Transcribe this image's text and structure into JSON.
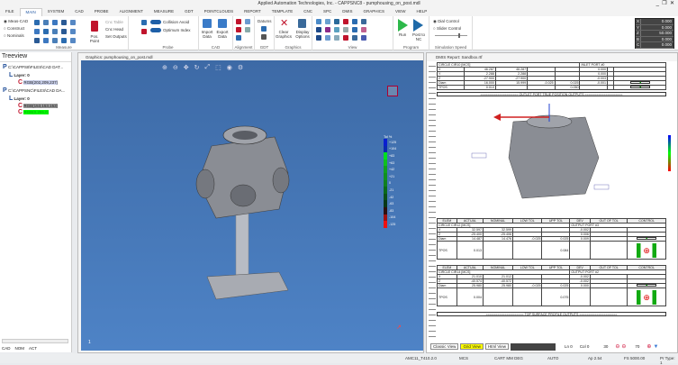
{
  "app": {
    "title": "Applied Automation Technologies, Inc. - CAPPSNC8 - pumphousing_on_post.mdl"
  },
  "tabs": [
    "FILE",
    "MAIN",
    "SYSTEM",
    "CAD",
    "PROBE",
    "ALIGNMENT",
    "MEASURE",
    "GDT",
    "POINTCLOUDS",
    "REPORT",
    "TEMPLATE",
    "CNC",
    "SPC",
    "DMIS",
    "GRAPHICS",
    "VIEW",
    "HELP"
  ],
  "ribbon": {
    "measure": {
      "radios": [
        "Meas-CAD",
        "Construct",
        "Nominals"
      ],
      "pos_point": "Pos. Point",
      "cnc_table": "Cnc Table",
      "cnc_head": "Cnc Head",
      "set_outputs": "Set Outputs",
      "label": "Measure"
    },
    "probe": {
      "collision": "Collision Avoid",
      "optimum": "Optimum Index",
      "label": "Probe"
    },
    "cad": {
      "import": "Import Data",
      "export": "Export Data",
      "label": "CAD"
    },
    "alignment": {
      "label": "Alignment"
    },
    "gdt": {
      "datums": "Datums",
      "label": "GDT"
    },
    "graphics": {
      "clear": "Clear Graphics",
      "display": "Display Options",
      "label": "Graphics"
    },
    "view": {
      "label": "View"
    },
    "program": {
      "run": "Run",
      "post": "Post to NC",
      "label": "Program"
    },
    "sim": {
      "dial": "Dial Control",
      "slider": "Slider Control",
      "label": "Simulation Speed"
    }
  },
  "dro": [
    {
      "axis": "X",
      "value": "0.000"
    },
    {
      "axis": "Y",
      "value": "0.000"
    },
    {
      "axis": "Z",
      "value": "50.000"
    },
    {
      "axis": "B",
      "value": "0.000"
    },
    {
      "axis": "C",
      "value": "0.000"
    }
  ],
  "tree": {
    "title": "Treeview",
    "p1": "C:\\CAPPS8\\FILES\\CAD DAT...",
    "layer1": "Layer: 0",
    "c1": "RGB(202,209,237)",
    "p2": "C:\\CAPPSNC\\FILES\\CAD DA...",
    "layer2": "Layer: 0",
    "c2": "RGB(153,153,153)",
    "c3": "RGB(0,255,0)",
    "tabs": [
      "CAD",
      "NOM",
      "ACT"
    ]
  },
  "graphics": {
    "title": "Graphics: pumphousing_on_post.mdl",
    "page": "1",
    "legend_title": "Tol %",
    "legend": [
      "+125",
      "+104",
      "+83",
      "+63",
      "+42",
      "+21",
      "0",
      "-21",
      "-42",
      "-63",
      "-83",
      "-104",
      "-125"
    ],
    "legend_colors": [
      "#0a1fd0",
      "#0a2ab0",
      "#00e020",
      "#10c020",
      "#10a020",
      "#109020",
      "#108020",
      "#0a6a1a",
      "#0a501a",
      "#083818",
      "#301010",
      "#a01010",
      "#f01010"
    ]
  },
  "report": {
    "title": "DMIS Report: Sandbox.rtf",
    "cols": [
      "ELEM",
      "ACTUAL",
      "NOMINAL",
      "LOW TOL",
      "UPP TOL",
      "DEV",
      "OUT OF TOL",
      "CONTROL"
    ],
    "t1": {
      "feature": "CIRCLE CIR10 [MCS]",
      "label": "INLET PORT #0",
      "rows": [
        [
          "X",
          "46.287",
          "46.287",
          "",
          "",
          "0.000"
        ],
        [
          "Y",
          "2.288",
          "2.288",
          "",
          "",
          "0.000"
        ],
        [
          "Z",
          "-27.900",
          "-27.900",
          "",
          "",
          "-0.003"
        ],
        [
          "Diam",
          "16.000",
          "15.999",
          "-0.025",
          "0.025",
          "-0.001"
        ],
        [
          "TPOS",
          "0.010",
          "",
          "",
          "0.050",
          ""
        ]
      ]
    },
    "banner1": "====================  OUTLET PORT TRUE POSITION OUTPUTS  ====================",
    "t2": {
      "num": "7",
      "feature": "CIRCLE CIR12 [MCS]",
      "label": "OUTPUT PORT #3",
      "rows": [
        [
          "X",
          "32.597",
          "32.599",
          "",
          "",
          "-0.002"
        ],
        [
          "Z",
          "-25.400",
          "-25.406",
          "",
          "",
          "0.006"
        ],
        [
          "Diam",
          "14.487",
          "14.476",
          "-0.025",
          "0.025",
          "0.009"
        ],
        [
          "TPOS",
          "0.013",
          "",
          "",
          "0.084",
          ""
        ]
      ]
    },
    "t3": {
      "num": "8",
      "feature": "CIRCLE CIR14 [MCS]",
      "label": "OUTPUT PORT #2",
      "rows": [
        [
          "X",
          "21.010",
          "21.012",
          "",
          "",
          "-0.002"
        ],
        [
          "Z",
          "-40.574",
          "-40.572",
          "",
          "",
          "-0.002"
        ],
        [
          "Diam",
          "25.980",
          "25.980",
          "-0.025",
          "0.025",
          "0.000"
        ],
        [
          "TPOS",
          "0.004",
          "",
          "",
          "0.075",
          ""
        ]
      ]
    },
    "banner2": "====================  TOP SURFACE PROFILE OUTPUTS  ====================",
    "views": [
      "Classic View",
      "Grid View",
      "Html View"
    ],
    "ln": "Ln 0",
    "col": "Col 0",
    "v1": "30",
    "v2": "70"
  },
  "status": [
    "AMC11_T410.2.0",
    "MCS",
    "CART MM DEG",
    "AUTO",
    "Ap 2.54",
    "FS 5000.00",
    "Pr Type: 1"
  ]
}
